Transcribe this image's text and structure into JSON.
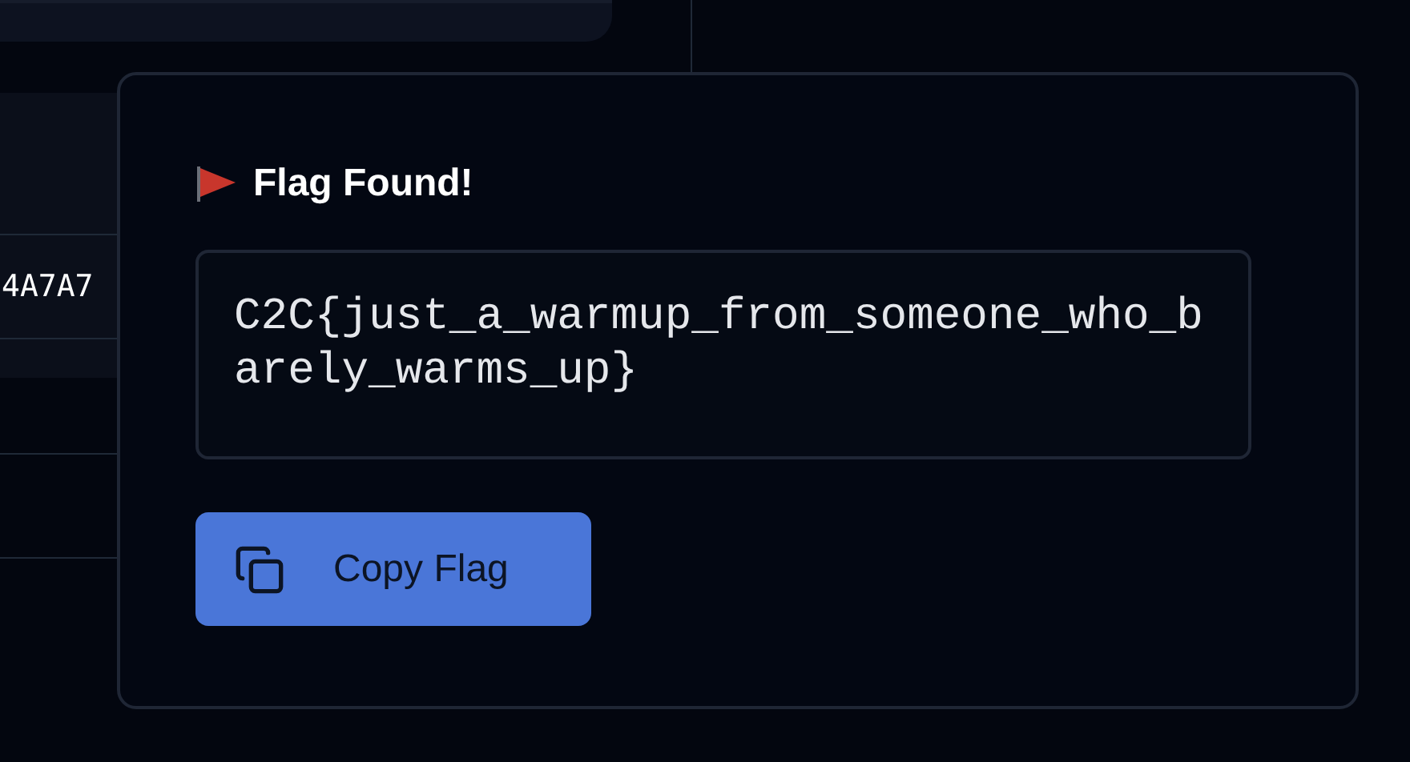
{
  "background": {
    "cell_text": "4A7A7"
  },
  "dialog": {
    "title": "Flag Found!",
    "flag": "C2C{just_a_warmup_from_someone_who_barely_warms_up}",
    "button": "Copy Flag"
  }
}
